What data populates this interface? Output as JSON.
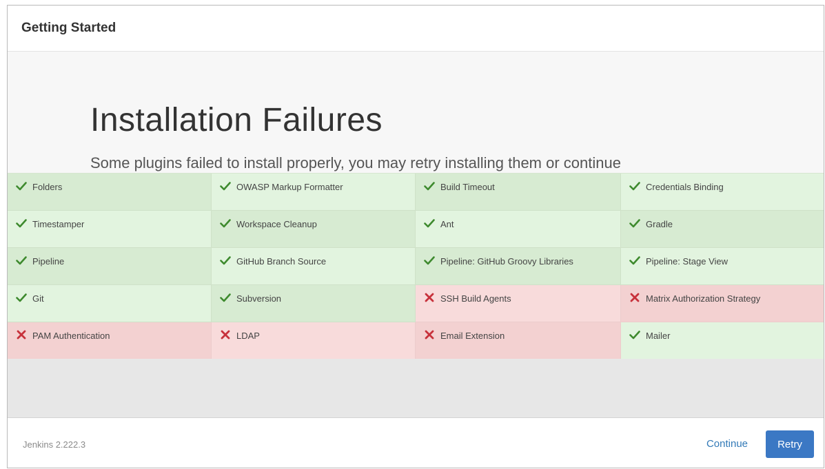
{
  "header": {
    "title": "Getting Started"
  },
  "main": {
    "title": "Installation Failures",
    "subtitle": "Some plugins failed to install properly, you may retry installing them or continue"
  },
  "plugins": [
    {
      "name": "Folders",
      "status": "success"
    },
    {
      "name": "OWASP Markup Formatter",
      "status": "success"
    },
    {
      "name": "Build Timeout",
      "status": "success"
    },
    {
      "name": "Credentials Binding",
      "status": "success"
    },
    {
      "name": "Timestamper",
      "status": "success"
    },
    {
      "name": "Workspace Cleanup",
      "status": "success"
    },
    {
      "name": "Ant",
      "status": "success"
    },
    {
      "name": "Gradle",
      "status": "success"
    },
    {
      "name": "Pipeline",
      "status": "success"
    },
    {
      "name": "GitHub Branch Source",
      "status": "success"
    },
    {
      "name": "Pipeline: GitHub Groovy Libraries",
      "status": "success"
    },
    {
      "name": "Pipeline: Stage View",
      "status": "success"
    },
    {
      "name": "Git",
      "status": "success"
    },
    {
      "name": "Subversion",
      "status": "success"
    },
    {
      "name": "SSH Build Agents",
      "status": "failure"
    },
    {
      "name": "Matrix Authorization Strategy",
      "status": "failure"
    },
    {
      "name": "PAM Authentication",
      "status": "failure"
    },
    {
      "name": "LDAP",
      "status": "failure"
    },
    {
      "name": "Email Extension",
      "status": "failure"
    },
    {
      "name": "Mailer",
      "status": "success"
    }
  ],
  "icons": {
    "success": "check-icon",
    "failure": "x-icon"
  },
  "colors": {
    "success_bg": "#e2f4df",
    "failure_bg": "#f8dbdb",
    "success_icon": "#3e8a2e",
    "failure_icon": "#c7313b",
    "primary": "#3b78c4"
  },
  "footer": {
    "version": "Jenkins 2.222.3",
    "continue_label": "Continue",
    "retry_label": "Retry"
  }
}
